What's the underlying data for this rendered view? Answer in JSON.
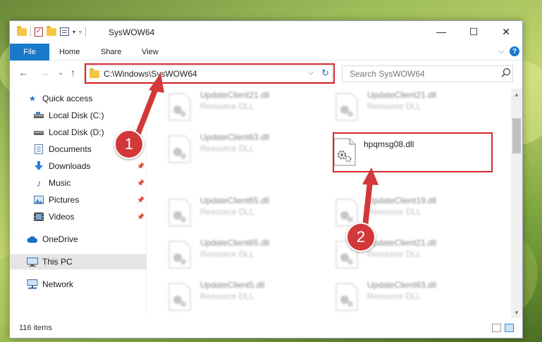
{
  "window": {
    "title": "SysWOW64",
    "controls": {
      "minimize": "—",
      "maximize": "☐",
      "close": "✕"
    }
  },
  "ribbon": {
    "tabs": [
      "File",
      "Home",
      "Share",
      "View"
    ],
    "collapse_glyph": "⌵",
    "help_glyph": "?"
  },
  "address": {
    "path": "C:\\Windows\\SysWOW64",
    "dropdown_glyph": "⌵",
    "refresh_glyph": "↻",
    "back_glyph": "←",
    "forward_glyph": "→",
    "recent_glyph": "⌄",
    "up_glyph": "↑"
  },
  "search": {
    "placeholder": "Search SysWOW64"
  },
  "nav": {
    "items": [
      {
        "label": "Quick access",
        "icon": "star-icon"
      },
      {
        "label": "Local Disk (C:)",
        "icon": "drive-icon"
      },
      {
        "label": "Local Disk (D:)",
        "icon": "drive-icon"
      },
      {
        "label": "Documents",
        "icon": "documents-icon"
      },
      {
        "label": "Downloads",
        "icon": "downloads-icon"
      },
      {
        "label": "Music",
        "icon": "music-icon"
      },
      {
        "label": "Pictures",
        "icon": "pictures-icon"
      },
      {
        "label": "Videos",
        "icon": "videos-icon"
      },
      {
        "label": "OneDrive",
        "icon": "cloud-icon"
      },
      {
        "label": "This PC",
        "icon": "computer-icon"
      },
      {
        "label": "Network",
        "icon": "network-icon"
      }
    ],
    "pin_glyph": "📌"
  },
  "files": [
    {
      "name": "UpdateClient21.dll",
      "type": "Resource DLL"
    },
    {
      "name": "UpdateClient21.dll",
      "type": "Resource DLL"
    },
    {
      "name": "UpdateClient63.dll",
      "type": "Resource DLL"
    },
    {
      "name": "hpqmsg08.dll",
      "type": ""
    },
    {
      "name": "UpdateClient65.dll",
      "type": "Resource DLL"
    },
    {
      "name": "UpdateClient19.dll",
      "type": "Resource DLL"
    },
    {
      "name": "UpdateClient65.dll",
      "type": "Resource DLL"
    },
    {
      "name": "UpdateClient21.dll",
      "type": "Resource DLL"
    },
    {
      "name": "UpdateClient5.dll",
      "type": "Resource DLL"
    },
    {
      "name": "UpdateClient63.dll",
      "type": "Resource DLL"
    }
  ],
  "status": {
    "item_count": "116 items"
  },
  "annotations": {
    "badge1": "1",
    "badge2": "2",
    "color": "#d2383a"
  },
  "scroll": {
    "up_glyph": "▲",
    "down_glyph": "▼"
  }
}
